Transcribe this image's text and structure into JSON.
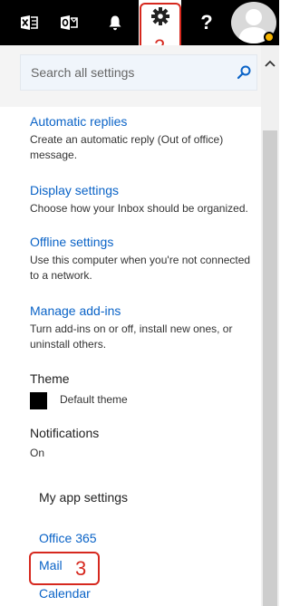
{
  "topbar": {
    "icons": [
      "excel-icon",
      "outlook-icon",
      "bell-icon",
      "gear-icon",
      "help-icon"
    ],
    "help_label": "?",
    "annotation_gear": "2"
  },
  "search": {
    "placeholder": "Search all settings"
  },
  "settings": [
    {
      "title": "Automatic replies",
      "description": "Create an automatic reply (Out of office) message."
    },
    {
      "title": "Display settings",
      "description": "Choose how your Inbox should be organized."
    },
    {
      "title": "Offline settings",
      "description": "Use this computer when you're not connected to a network."
    },
    {
      "title": "Manage add-ins",
      "description": "Turn add-ins on or off, install new ones, or uninstall others."
    }
  ],
  "theme": {
    "label": "Theme",
    "value": "Default theme"
  },
  "notifications": {
    "label": "Notifications",
    "value": "On"
  },
  "my_app_settings": {
    "heading": "My app settings",
    "apps": [
      "Office 365",
      "Mail",
      "Calendar"
    ],
    "annotation_mail": "3"
  },
  "colors": {
    "link": "#0a63c7",
    "topbar": "#000000",
    "annotation": "#d6281e",
    "presence": "#f7b500"
  }
}
